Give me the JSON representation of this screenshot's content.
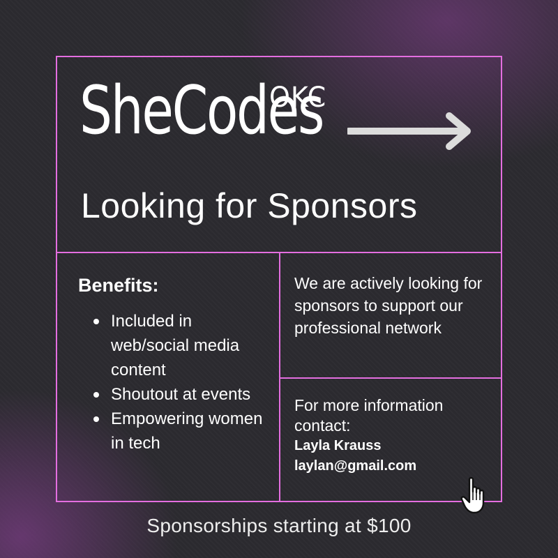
{
  "brand": {
    "name": "SheCodes",
    "city": "OKC"
  },
  "headline": "Looking for Sponsors",
  "benefits": {
    "title": "Benefits:",
    "items": [
      "Included in web/social media content",
      "Shoutout at events",
      "Empowering women in tech"
    ]
  },
  "info": {
    "text": "We are actively looking for sponsors to support our professional network"
  },
  "contact": {
    "intro": "For more information contact:",
    "name": "Layla Krauss",
    "email": "laylan@gmail.com"
  },
  "footer": "Sponsorships starting at $100",
  "colors": {
    "accent": "#e46ee0",
    "background": "#2c2b30",
    "glow": "#7a3c82",
    "arrow": "#dcdcdc"
  },
  "icons": [
    "arrow-right-icon",
    "hand-pointer-icon"
  ]
}
